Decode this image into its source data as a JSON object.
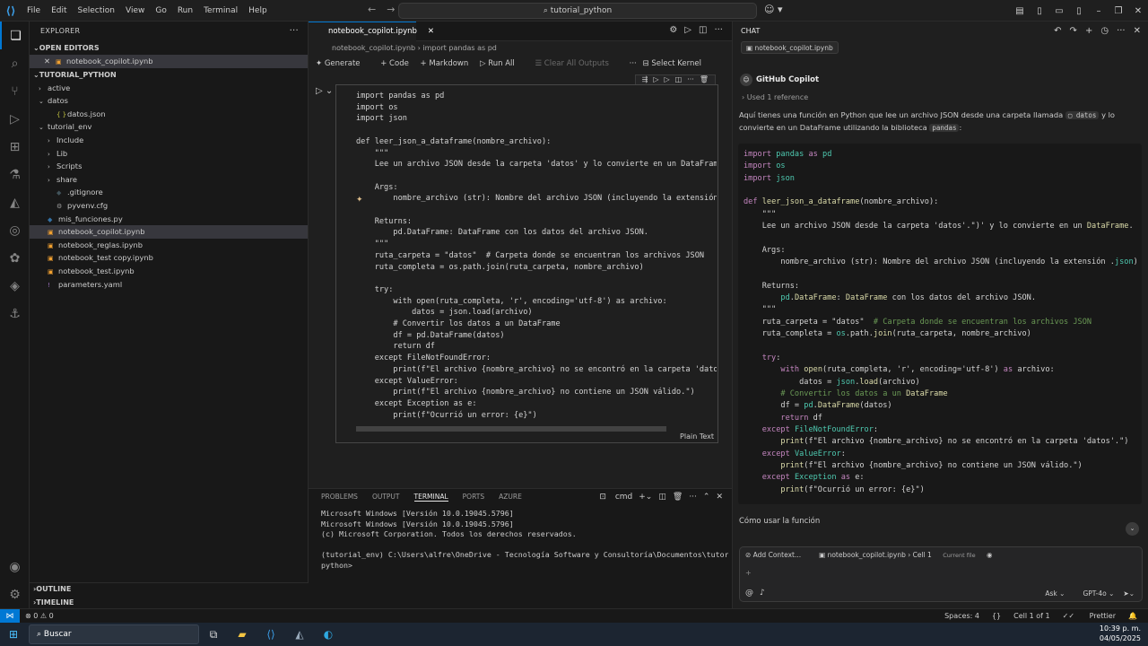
{
  "titlebar": {
    "menu": [
      "File",
      "Edit",
      "Selection",
      "View",
      "Go",
      "Run",
      "Terminal",
      "Help"
    ],
    "search": "tutorial_python"
  },
  "explorer": {
    "title": "EXPLORER",
    "open_editors": "OPEN EDITORS",
    "open_file": "notebook_copilot.ipynb",
    "project": "TUTORIAL_PYTHON",
    "tree": [
      {
        "label": "active",
        "depth": 1,
        "kind": "folder"
      },
      {
        "label": "datos",
        "depth": 1,
        "kind": "folder-open"
      },
      {
        "label": "datos.json",
        "depth": 2,
        "kind": "json"
      },
      {
        "label": "tutorial_env",
        "depth": 1,
        "kind": "folder-open"
      },
      {
        "label": "Include",
        "depth": 2,
        "kind": "folder"
      },
      {
        "label": "Lib",
        "depth": 2,
        "kind": "folder"
      },
      {
        "label": "Scripts",
        "depth": 2,
        "kind": "folder"
      },
      {
        "label": "share",
        "depth": 2,
        "kind": "folder"
      },
      {
        "label": ".gitignore",
        "depth": 2,
        "kind": "git"
      },
      {
        "label": "pyvenv.cfg",
        "depth": 2,
        "kind": "cfg"
      },
      {
        "label": "mis_funciones.py",
        "depth": 1,
        "kind": "py"
      },
      {
        "label": "notebook_copilot.ipynb",
        "depth": 1,
        "kind": "nb",
        "selected": true
      },
      {
        "label": "notebook_reglas.ipynb",
        "depth": 1,
        "kind": "nb"
      },
      {
        "label": "notebook_test copy.ipynb",
        "depth": 1,
        "kind": "nb"
      },
      {
        "label": "notebook_test.ipynb",
        "depth": 1,
        "kind": "nb"
      },
      {
        "label": "parameters.yaml",
        "depth": 1,
        "kind": "yaml"
      }
    ],
    "outline": "OUTLINE",
    "timeline": "TIMELINE"
  },
  "editor": {
    "tab": "notebook_copilot.ipynb",
    "breadcrumb": [
      "notebook_copilot.ipynb",
      "import pandas as pd"
    ],
    "toolbar": {
      "generate": "Generate",
      "code": "+ Code",
      "markdown": "+ Markdown",
      "run_all": "Run All",
      "clear": "Clear All Outputs",
      "select_kernel": "Select Kernel"
    },
    "cell_lang": "Plain Text",
    "code": [
      "import pandas as pd",
      "import os",
      "import json",
      "",
      "def leer_json_a_dataframe(nombre_archivo):",
      "    \"\"\"",
      "    Lee un archivo JSON desde la carpeta 'datos' y lo convierte en un DataFrame",
      "",
      "    Args:",
      "        nombre_archivo (str): Nombre del archivo JSON (incluyendo la extensión",
      "",
      "    Returns:",
      "        pd.DataFrame: DataFrame con los datos del archivo JSON.",
      "    \"\"\"",
      "    ruta_carpeta = \"datos\"  # Carpeta donde se encuentran los archivos JSON",
      "    ruta_completa = os.path.join(ruta_carpeta, nombre_archivo)",
      "",
      "    try:",
      "        with open(ruta_completa, 'r', encoding='utf-8') as archivo:",
      "            datos = json.load(archivo)",
      "        # Convertir los datos a un DataFrame",
      "        df = pd.DataFrame(datos)",
      "        return df",
      "    except FileNotFoundError:",
      "        print(f\"El archivo {nombre_archivo} no se encontró en la carpeta 'datos",
      "    except ValueError:",
      "        print(f\"El archivo {nombre_archivo} no contiene un JSON válido.\")",
      "    except Exception as e:",
      "        print(f\"Ocurrió un error: {e}\")"
    ]
  },
  "panel": {
    "tabs": [
      "PROBLEMS",
      "OUTPUT",
      "TERMINAL",
      "PORTS",
      "AZURE"
    ],
    "active": "TERMINAL",
    "shell": "cmd",
    "lines": [
      "Microsoft Windows [Versión 10.0.19045.5796]",
      "Microsoft Windows [Versión 10.0.19045.5796]",
      "(c) Microsoft Corporation. Todos los derechos reservados.",
      "",
      "(tutorial_env) C:\\Users\\alfre\\OneDrive - Tecnología Software y Consultoría\\Documentos\\tutorial_",
      "python>"
    ]
  },
  "chat": {
    "title": "CHAT",
    "context_chip": "notebook_copilot.ipynb",
    "assistant": "GitHub Copilot",
    "used": "Used 1 reference",
    "intro": {
      "a": "Aquí tienes una función en Python que lee un archivo JSON desde una carpeta llamada",
      "folder": "datos",
      "b": "y lo convierte en un DataFrame utilizando la biblioteca",
      "lib": "pandas",
      ":": ":"
    },
    "howto": "Cómo usar la función",
    "input": {
      "add_context": "Add Context...",
      "file": "notebook_copilot.ipynb › Cell 1",
      "current": "Current file",
      "mode": "Ask",
      "model": "GPT-4o"
    }
  },
  "statusbar": {
    "errors": "0",
    "warnings": "0",
    "spaces": "Spaces: 4",
    "braces": "{}",
    "cell": "Cell 1 of 1",
    "prettier": "Prettier"
  },
  "taskbar": {
    "search": "Buscar",
    "time": "10:39 p. m.",
    "date": "04/05/2025"
  }
}
